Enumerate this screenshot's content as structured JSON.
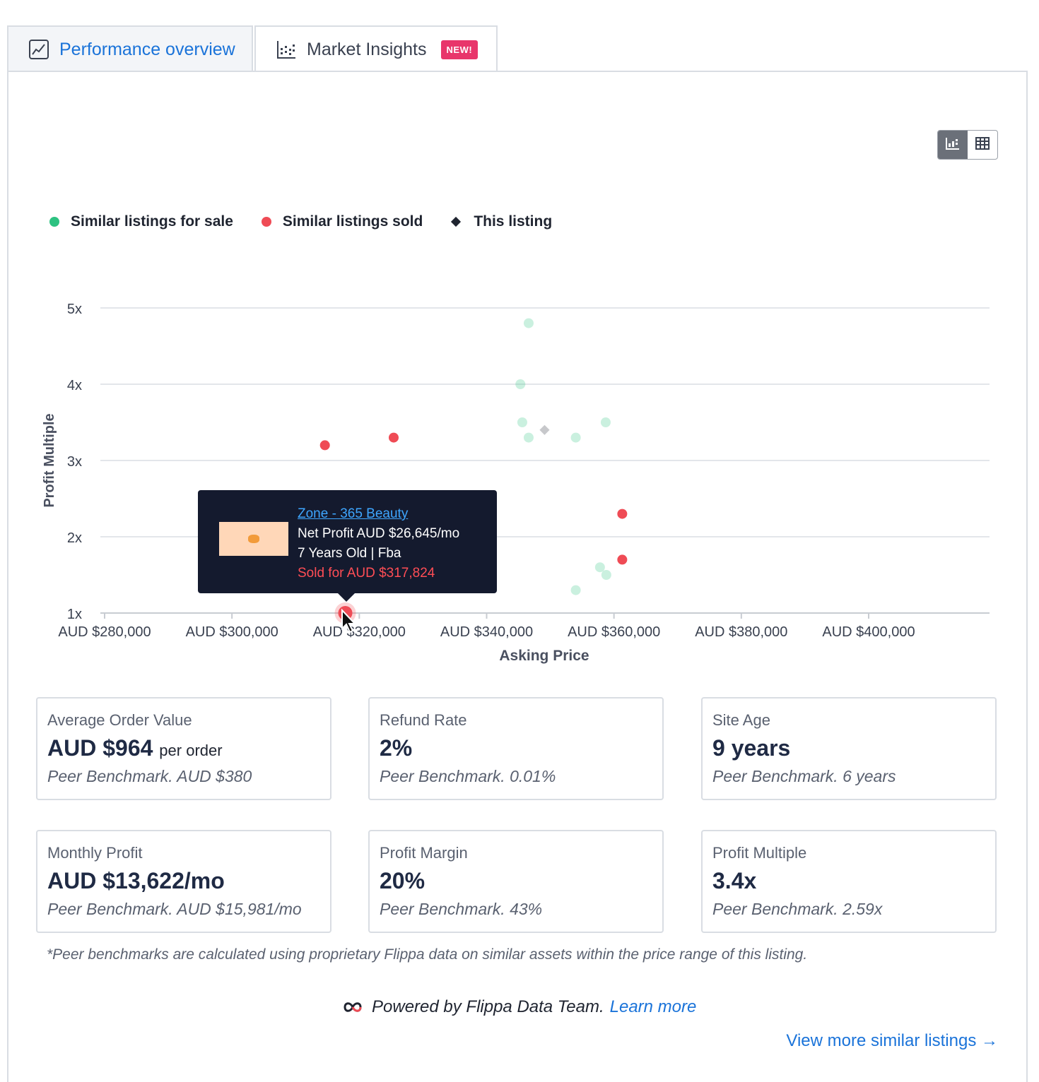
{
  "tabs": {
    "performance_label": "Performance overview",
    "market_label": "Market Insights",
    "new_badge": "NEW!"
  },
  "legend": {
    "for_sale": "Similar listings for sale",
    "sold": "Similar listings sold",
    "this_listing": "This listing"
  },
  "colors": {
    "for_sale": "#2dc281",
    "sold": "#ef4b55",
    "this_listing": "#1f2430",
    "accent": "#1a73d9",
    "badge": "#e8366b"
  },
  "chart_data": {
    "type": "scatter",
    "xlabel": "Asking Price",
    "ylabel": "Profit Multiple",
    "xlim": [
      280000,
      400000
    ],
    "ylim": [
      1,
      5
    ],
    "x_ticks": [
      280000,
      300000,
      320000,
      340000,
      360000,
      380000,
      400000
    ],
    "x_tick_labels": [
      "AUD $280,000",
      "AUD $300,000",
      "AUD $320,000",
      "AUD $340,000",
      "AUD $360,000",
      "AUD $380,000",
      "AUD $400,000"
    ],
    "y_ticks": [
      1,
      2,
      3,
      4,
      5
    ],
    "y_tick_labels": [
      "1x",
      "2x",
      "3x",
      "4x",
      "5x"
    ],
    "grid": true,
    "legend_position": "top-left",
    "series": [
      {
        "name": "Similar listings for sale",
        "points": [
          [
            346600,
            4.8
          ],
          [
            345300,
            4.0
          ],
          [
            345600,
            3.5
          ],
          [
            346600,
            3.3
          ],
          [
            354000,
            3.3
          ],
          [
            358700,
            3.5
          ],
          [
            357800,
            1.6
          ],
          [
            358800,
            1.5
          ],
          [
            354000,
            1.3
          ]
        ]
      },
      {
        "name": "Similar listings sold",
        "points": [
          [
            314600,
            3.2
          ],
          [
            325400,
            3.3
          ],
          [
            361300,
            2.3
          ],
          [
            361300,
            1.7
          ],
          [
            317800,
            1.0
          ]
        ]
      },
      {
        "name": "This listing",
        "points": [
          [
            349100,
            3.4
          ]
        ]
      }
    ]
  },
  "tooltip": {
    "title": "Zone - 365 Beauty",
    "net_profit": "Net Profit AUD $26,645/mo",
    "age_type": "7 Years Old | Fba",
    "sold_for": "Sold for AUD $317,824"
  },
  "metrics": [
    {
      "label": "Average Order Value",
      "value": "AUD $964",
      "unit": "per order",
      "benchmark": "Peer Benchmark. AUD $380"
    },
    {
      "label": "Refund Rate",
      "value": "2%",
      "unit": "",
      "benchmark": "Peer Benchmark. 0.01%"
    },
    {
      "label": "Site Age",
      "value": "9 years",
      "unit": "",
      "benchmark": "Peer Benchmark. 6 years"
    },
    {
      "label": "Monthly Profit",
      "value": "AUD $13,622/mo",
      "unit": "",
      "benchmark": "Peer Benchmark. AUD $15,981/mo"
    },
    {
      "label": "Profit Margin",
      "value": "20%",
      "unit": "",
      "benchmark": "Peer Benchmark. 43%"
    },
    {
      "label": "Profit Multiple",
      "value": "3.4x",
      "unit": "",
      "benchmark": "Peer Benchmark. 2.59x"
    }
  ],
  "footnote": "*Peer benchmarks are calculated using proprietary Flippa data on similar assets within the price range of this listing.",
  "powered": {
    "text": "Powered by Flippa Data Team.",
    "link": "Learn more"
  },
  "view_more": "View more similar listings →"
}
